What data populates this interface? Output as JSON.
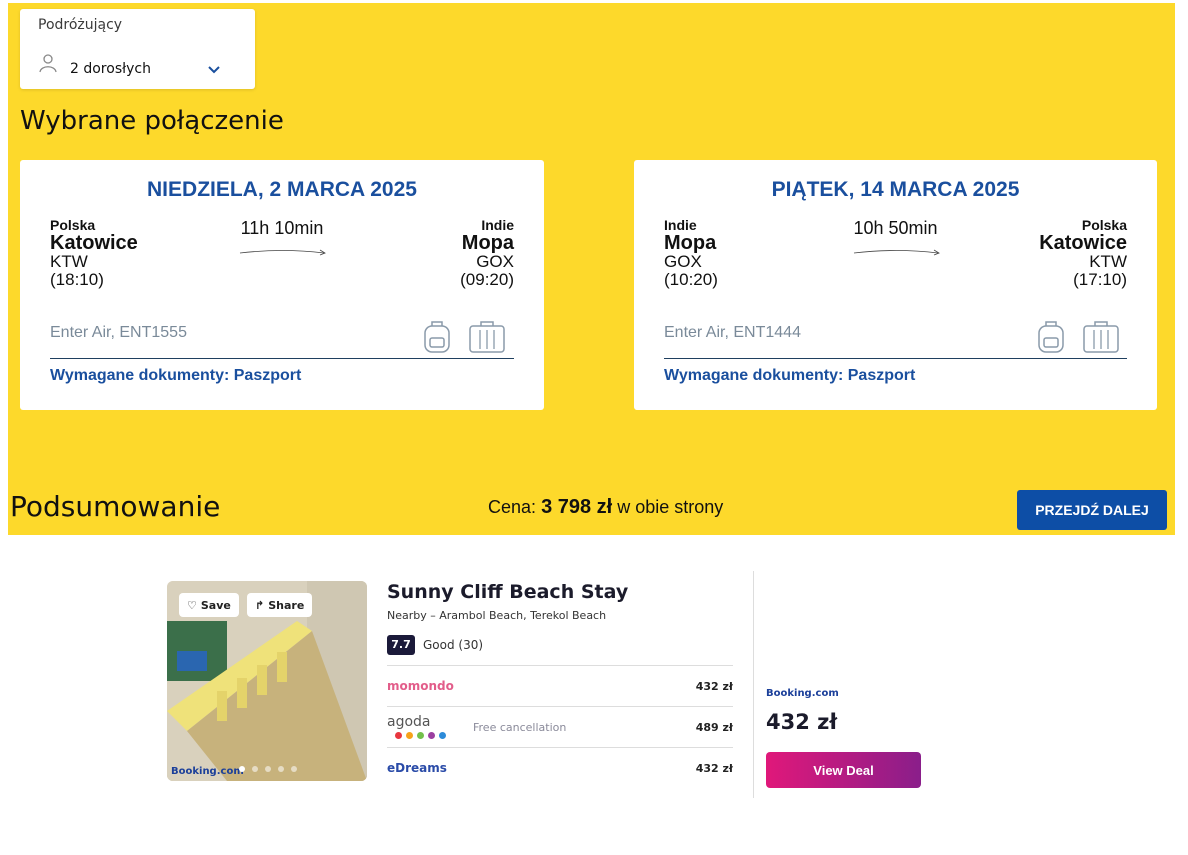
{
  "travelers": {
    "label": "Podróżujący",
    "value": "2 dorosłych"
  },
  "section_title": "Wybrane połączenie",
  "outbound": {
    "date": "NIEDZIELA, 2 MARCA 2025",
    "from": {
      "country": "Polska",
      "city": "Katowice",
      "code": "KTW",
      "time": "(18:10)"
    },
    "to": {
      "country": "Indie",
      "city": "Mopa",
      "code": "GOX",
      "time": "(09:20)"
    },
    "duration": "11h 10min",
    "flight": "Enter Air, ENT1555",
    "docs": "Wymagane dokumenty: Paszport"
  },
  "return": {
    "date": "PIĄTEK, 14 MARCA 2025",
    "from": {
      "country": "Indie",
      "city": "Mopa",
      "code": "GOX",
      "time": "(10:20)"
    },
    "to": {
      "country": "Polska",
      "city": "Katowice",
      "code": "KTW",
      "time": "(17:10)"
    },
    "duration": "10h 50min",
    "flight": "Enter Air, ENT1444",
    "docs": "Wymagane dokumenty: Paszport"
  },
  "summary": {
    "title": "Podsumowanie",
    "price_prefix": "Cena:",
    "price": "3 798 zł",
    "price_suffix": "w obie strony",
    "cta": "PRZEJDŹ DALEJ"
  },
  "ad": {
    "save": "Save",
    "share": "Share",
    "photo_brand": "Booking.com",
    "name": "Sunny Cliff Beach Stay",
    "nearby": "Nearby – Arambol Beach, Terekol Beach",
    "score": "7.7",
    "rating": "Good (30)",
    "offers": [
      {
        "provider": "momondo",
        "note": "",
        "price": "432 zł"
      },
      {
        "provider": "agoda",
        "note": "Free cancellation",
        "price": "489 zł"
      },
      {
        "provider": "eDreams",
        "note": "",
        "price": "432 zł"
      }
    ],
    "brand": "Booking.com",
    "best_price": "432 zł",
    "deal_button": "View Deal"
  },
  "colors": {
    "yellow": "#fdd92b",
    "blue": "#1a4f9e",
    "cta": "#0d4ea6"
  }
}
